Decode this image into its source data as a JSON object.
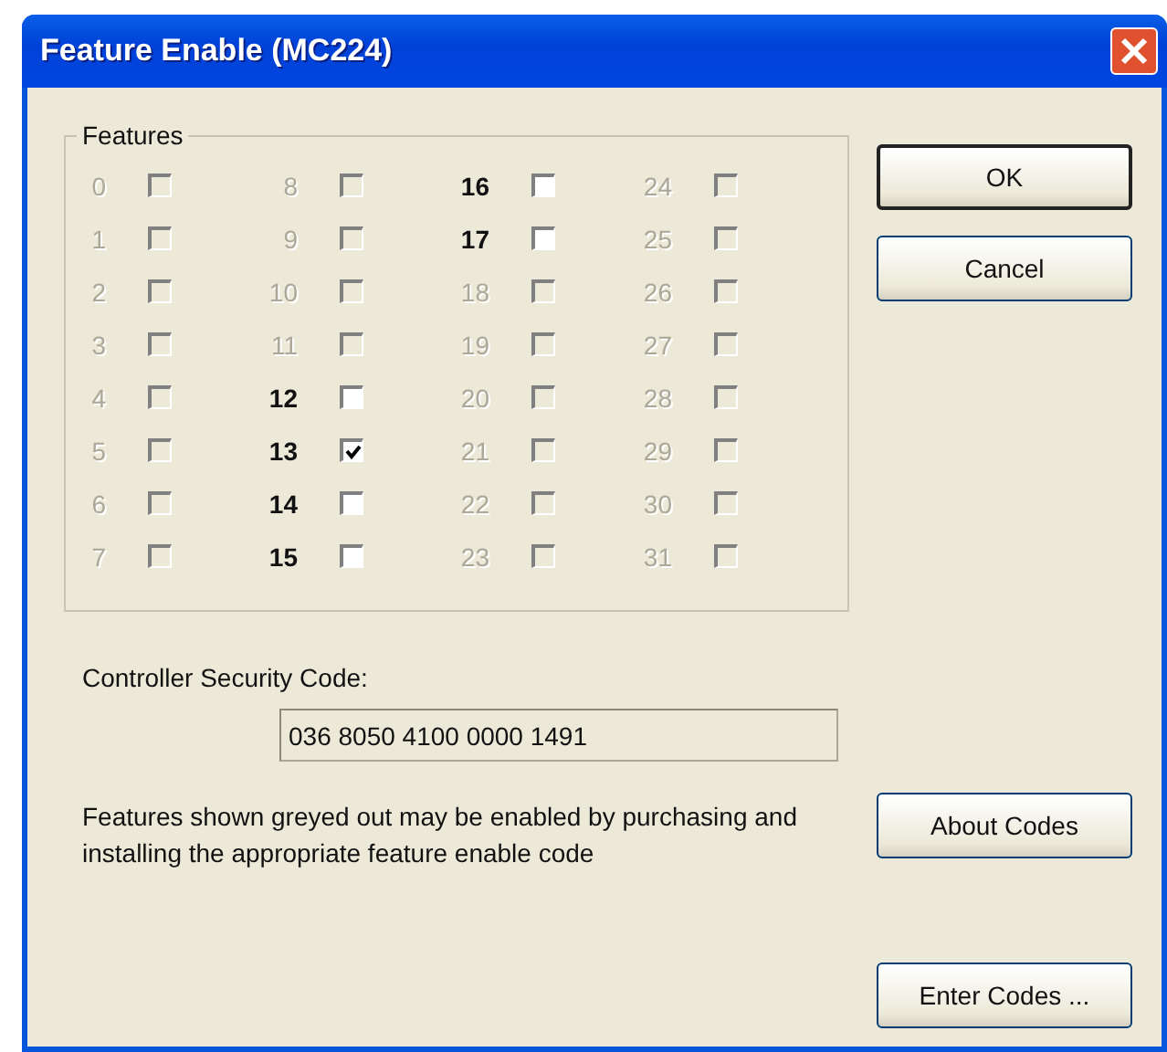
{
  "window": {
    "title": "Feature Enable (MC224)"
  },
  "features_group": {
    "title": "Features",
    "items": [
      {
        "number": "0",
        "disabled": true,
        "checked": false
      },
      {
        "number": "1",
        "disabled": true,
        "checked": false
      },
      {
        "number": "2",
        "disabled": true,
        "checked": false
      },
      {
        "number": "3",
        "disabled": true,
        "checked": false
      },
      {
        "number": "4",
        "disabled": true,
        "checked": false
      },
      {
        "number": "5",
        "disabled": true,
        "checked": false
      },
      {
        "number": "6",
        "disabled": true,
        "checked": false
      },
      {
        "number": "7",
        "disabled": true,
        "checked": false
      },
      {
        "number": "8",
        "disabled": true,
        "checked": false
      },
      {
        "number": "9",
        "disabled": true,
        "checked": false
      },
      {
        "number": "10",
        "disabled": true,
        "checked": false
      },
      {
        "number": "11",
        "disabled": true,
        "checked": false
      },
      {
        "number": "12",
        "disabled": false,
        "checked": false
      },
      {
        "number": "13",
        "disabled": false,
        "checked": true
      },
      {
        "number": "14",
        "disabled": false,
        "checked": false
      },
      {
        "number": "15",
        "disabled": false,
        "checked": false
      },
      {
        "number": "16",
        "disabled": false,
        "checked": false
      },
      {
        "number": "17",
        "disabled": false,
        "checked": false
      },
      {
        "number": "18",
        "disabled": true,
        "checked": false
      },
      {
        "number": "19",
        "disabled": true,
        "checked": false
      },
      {
        "number": "20",
        "disabled": true,
        "checked": false
      },
      {
        "number": "21",
        "disabled": true,
        "checked": false
      },
      {
        "number": "22",
        "disabled": true,
        "checked": false
      },
      {
        "number": "23",
        "disabled": true,
        "checked": false
      },
      {
        "number": "24",
        "disabled": true,
        "checked": false
      },
      {
        "number": "25",
        "disabled": true,
        "checked": false
      },
      {
        "number": "26",
        "disabled": true,
        "checked": false
      },
      {
        "number": "27",
        "disabled": true,
        "checked": false
      },
      {
        "number": "28",
        "disabled": true,
        "checked": false
      },
      {
        "number": "29",
        "disabled": true,
        "checked": false
      },
      {
        "number": "30",
        "disabled": true,
        "checked": false
      },
      {
        "number": "31",
        "disabled": true,
        "checked": false
      }
    ]
  },
  "security_code": {
    "label": "Controller Security Code:",
    "value": "036 8050 4100 0000 1491"
  },
  "note": "Features shown greyed out may be enabled by purchasing and installing the appropriate feature enable code",
  "buttons": {
    "top": [
      "OK",
      "Cancel"
    ],
    "about": "About Codes",
    "enter": "Enter Codes ..."
  }
}
